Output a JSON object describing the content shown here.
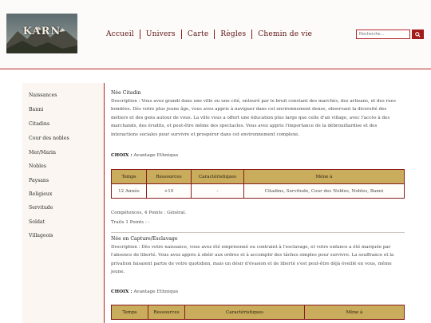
{
  "header": {
    "logo_text": "KARN",
    "nav": [
      "Accueil",
      "Univers",
      "Carte",
      "Règles",
      "Chemin de vie"
    ],
    "search_placeholder": "Recherche..."
  },
  "sidebar": {
    "items": [
      "Naissances",
      "Banni",
      "Citadins",
      "Cour des nobles",
      "Mer/Marin",
      "Nobles",
      "Paysans",
      "Religieux",
      "Servitude",
      "Soldat",
      "Villageois"
    ]
  },
  "sections": [
    {
      "title": "Née Citadin",
      "description": "Description : Vous avez grandi dans une ville ou une cité, entouré par le bruit constant des marchés, des artisans, et des rues bondées. Dès votre plus jeune âge, vous avez appris à naviguer dans cet environnement dense, observant la diversité des métiers et des gens autour de vous. La ville vous a offert une éducation plus large que celle d'un village, avec l'accès à des marchands, des érudits, et peut-être même des spectacles. Vous avez appris l'importance de la débrouillardise et des interactions sociales pour survivre et prospérer dans cet environnement complexe.",
      "choix_label": "CHOIX :",
      "choix_value": "Avantage Ethnique",
      "table": {
        "headers": [
          "Temps",
          "Ressources",
          "Caractéristiques",
          "Mène à"
        ],
        "rows": [
          [
            "12 Année",
            "+10",
            "-",
            "Citadins, Servitude, Cour des Nobles, Nobles, Banni"
          ]
        ]
      },
      "competences": "Compétences, 4 Points : Général.",
      "traits": "Traits 1 Points : -"
    },
    {
      "title": "Née en Capture/Esclavage",
      "description": "Description : Dès votre naissance, vous avez été emprisonné ou contraint à l'esclavage, et votre enfance a été marquée par l'absence de liberté. Vous avez appris à obéir aux ordres et à accomplir des tâches simples pour survivre. La souffrance et la privation faisaient partie de votre quotidien, mais un désir d'évasion et de liberté s'est peut-être déjà éveillé en vous, même jeune.",
      "choix_label": "CHOIX :",
      "choix_value": "Avantage Ethnique",
      "table": {
        "headers": [
          "Temps",
          "Ressources",
          "Caractéristiques",
          "Mène à"
        ]
      }
    }
  ],
  "colors": {
    "accent": "#b3262a",
    "table_header": "#c9ac5c",
    "nav_text": "#5a1010",
    "sidebar_bg": "#fbf6f1"
  }
}
